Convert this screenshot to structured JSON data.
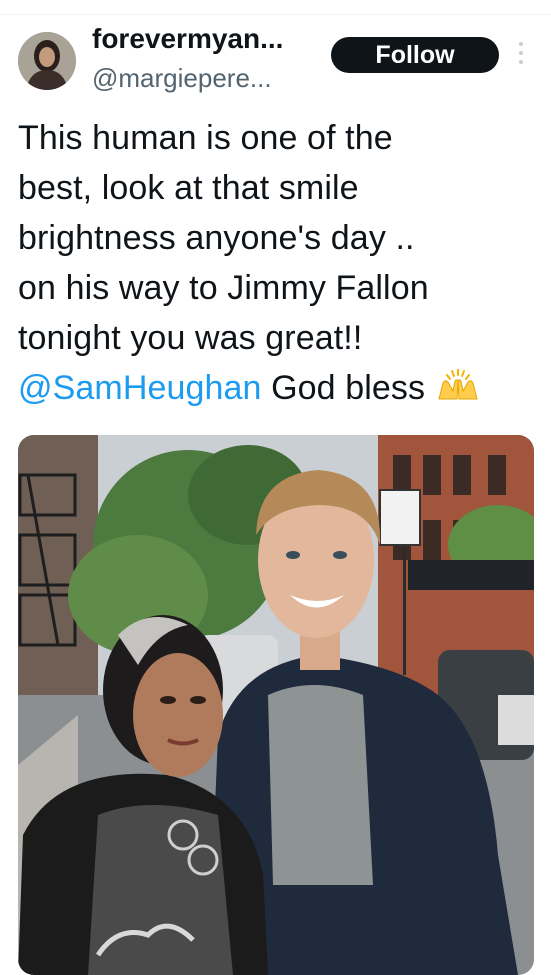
{
  "author": {
    "display_name": "forevermyan...",
    "handle": "@margiepere...",
    "avatar_icon": "user-avatar"
  },
  "actions": {
    "follow_label": "Follow",
    "more_icon": "more-vertical-icon"
  },
  "tweet": {
    "lines": [
      "This human is one of the",
      "best, look at that smile",
      "brightness  anyone's day ..",
      "on his way to Jimmy Fallon",
      "tonight you was great!!"
    ],
    "mention": "@SamHeughan",
    "closing": " God bless",
    "emoji": "raising-hands-emoji"
  },
  "media": {
    "type": "photo",
    "subject": "photo-of-two-people-on-city-street"
  },
  "colors": {
    "link": "#1d9bf0",
    "text": "#0f1419",
    "secondary": "#536471",
    "follow_bg": "#0f1419"
  }
}
